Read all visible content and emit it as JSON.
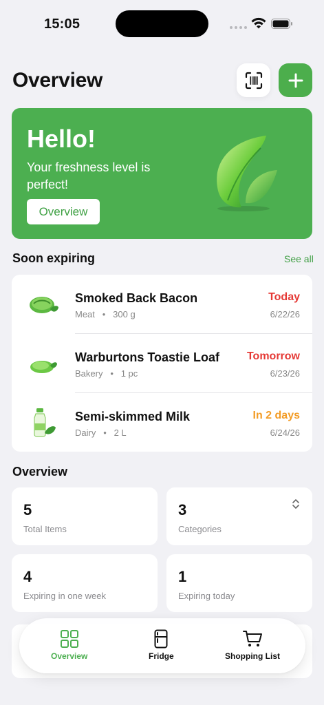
{
  "status_bar": {
    "time": "15:05"
  },
  "header": {
    "title": "Overview"
  },
  "hero": {
    "title": "Hello!",
    "subtitle": "Your freshness level is perfect!",
    "button_label": "Overview"
  },
  "soon_expiring": {
    "title": "Soon expiring",
    "see_all": "See all",
    "items": [
      {
        "name": "Smoked Back Bacon",
        "category": "Meat",
        "quantity": "300 g",
        "status": "Today",
        "status_color": "#e53935",
        "date": "6/22/26",
        "icon": "meat-icon"
      },
      {
        "name": "Warburtons Toastie Loaf",
        "category": "Bakery",
        "quantity": "1 pc",
        "status": "Tomorrow",
        "status_color": "#e53935",
        "date": "6/23/26",
        "icon": "bread-icon"
      },
      {
        "name": "Semi-skimmed Milk",
        "category": "Dairy",
        "quantity": "2 L",
        "status": "In 2 days",
        "status_color": "#f39c26",
        "date": "6/24/26",
        "icon": "milk-icon"
      }
    ]
  },
  "overview": {
    "title": "Overview",
    "stats": [
      {
        "value": "5",
        "label": "Total Items"
      },
      {
        "value": "3",
        "label": "Categories"
      },
      {
        "value": "4",
        "label": "Expiring in one week"
      },
      {
        "value": "1",
        "label": "Expiring today"
      }
    ]
  },
  "tabs": [
    {
      "label": "Overview",
      "icon": "grid-icon",
      "active": true
    },
    {
      "label": "Fridge",
      "icon": "fridge-icon",
      "active": false
    },
    {
      "label": "Shopping List",
      "icon": "cart-icon",
      "active": false
    }
  ],
  "colors": {
    "accent": "#4caf50",
    "background": "#f1f1f5",
    "danger": "#e53935",
    "warning": "#f39c26"
  }
}
